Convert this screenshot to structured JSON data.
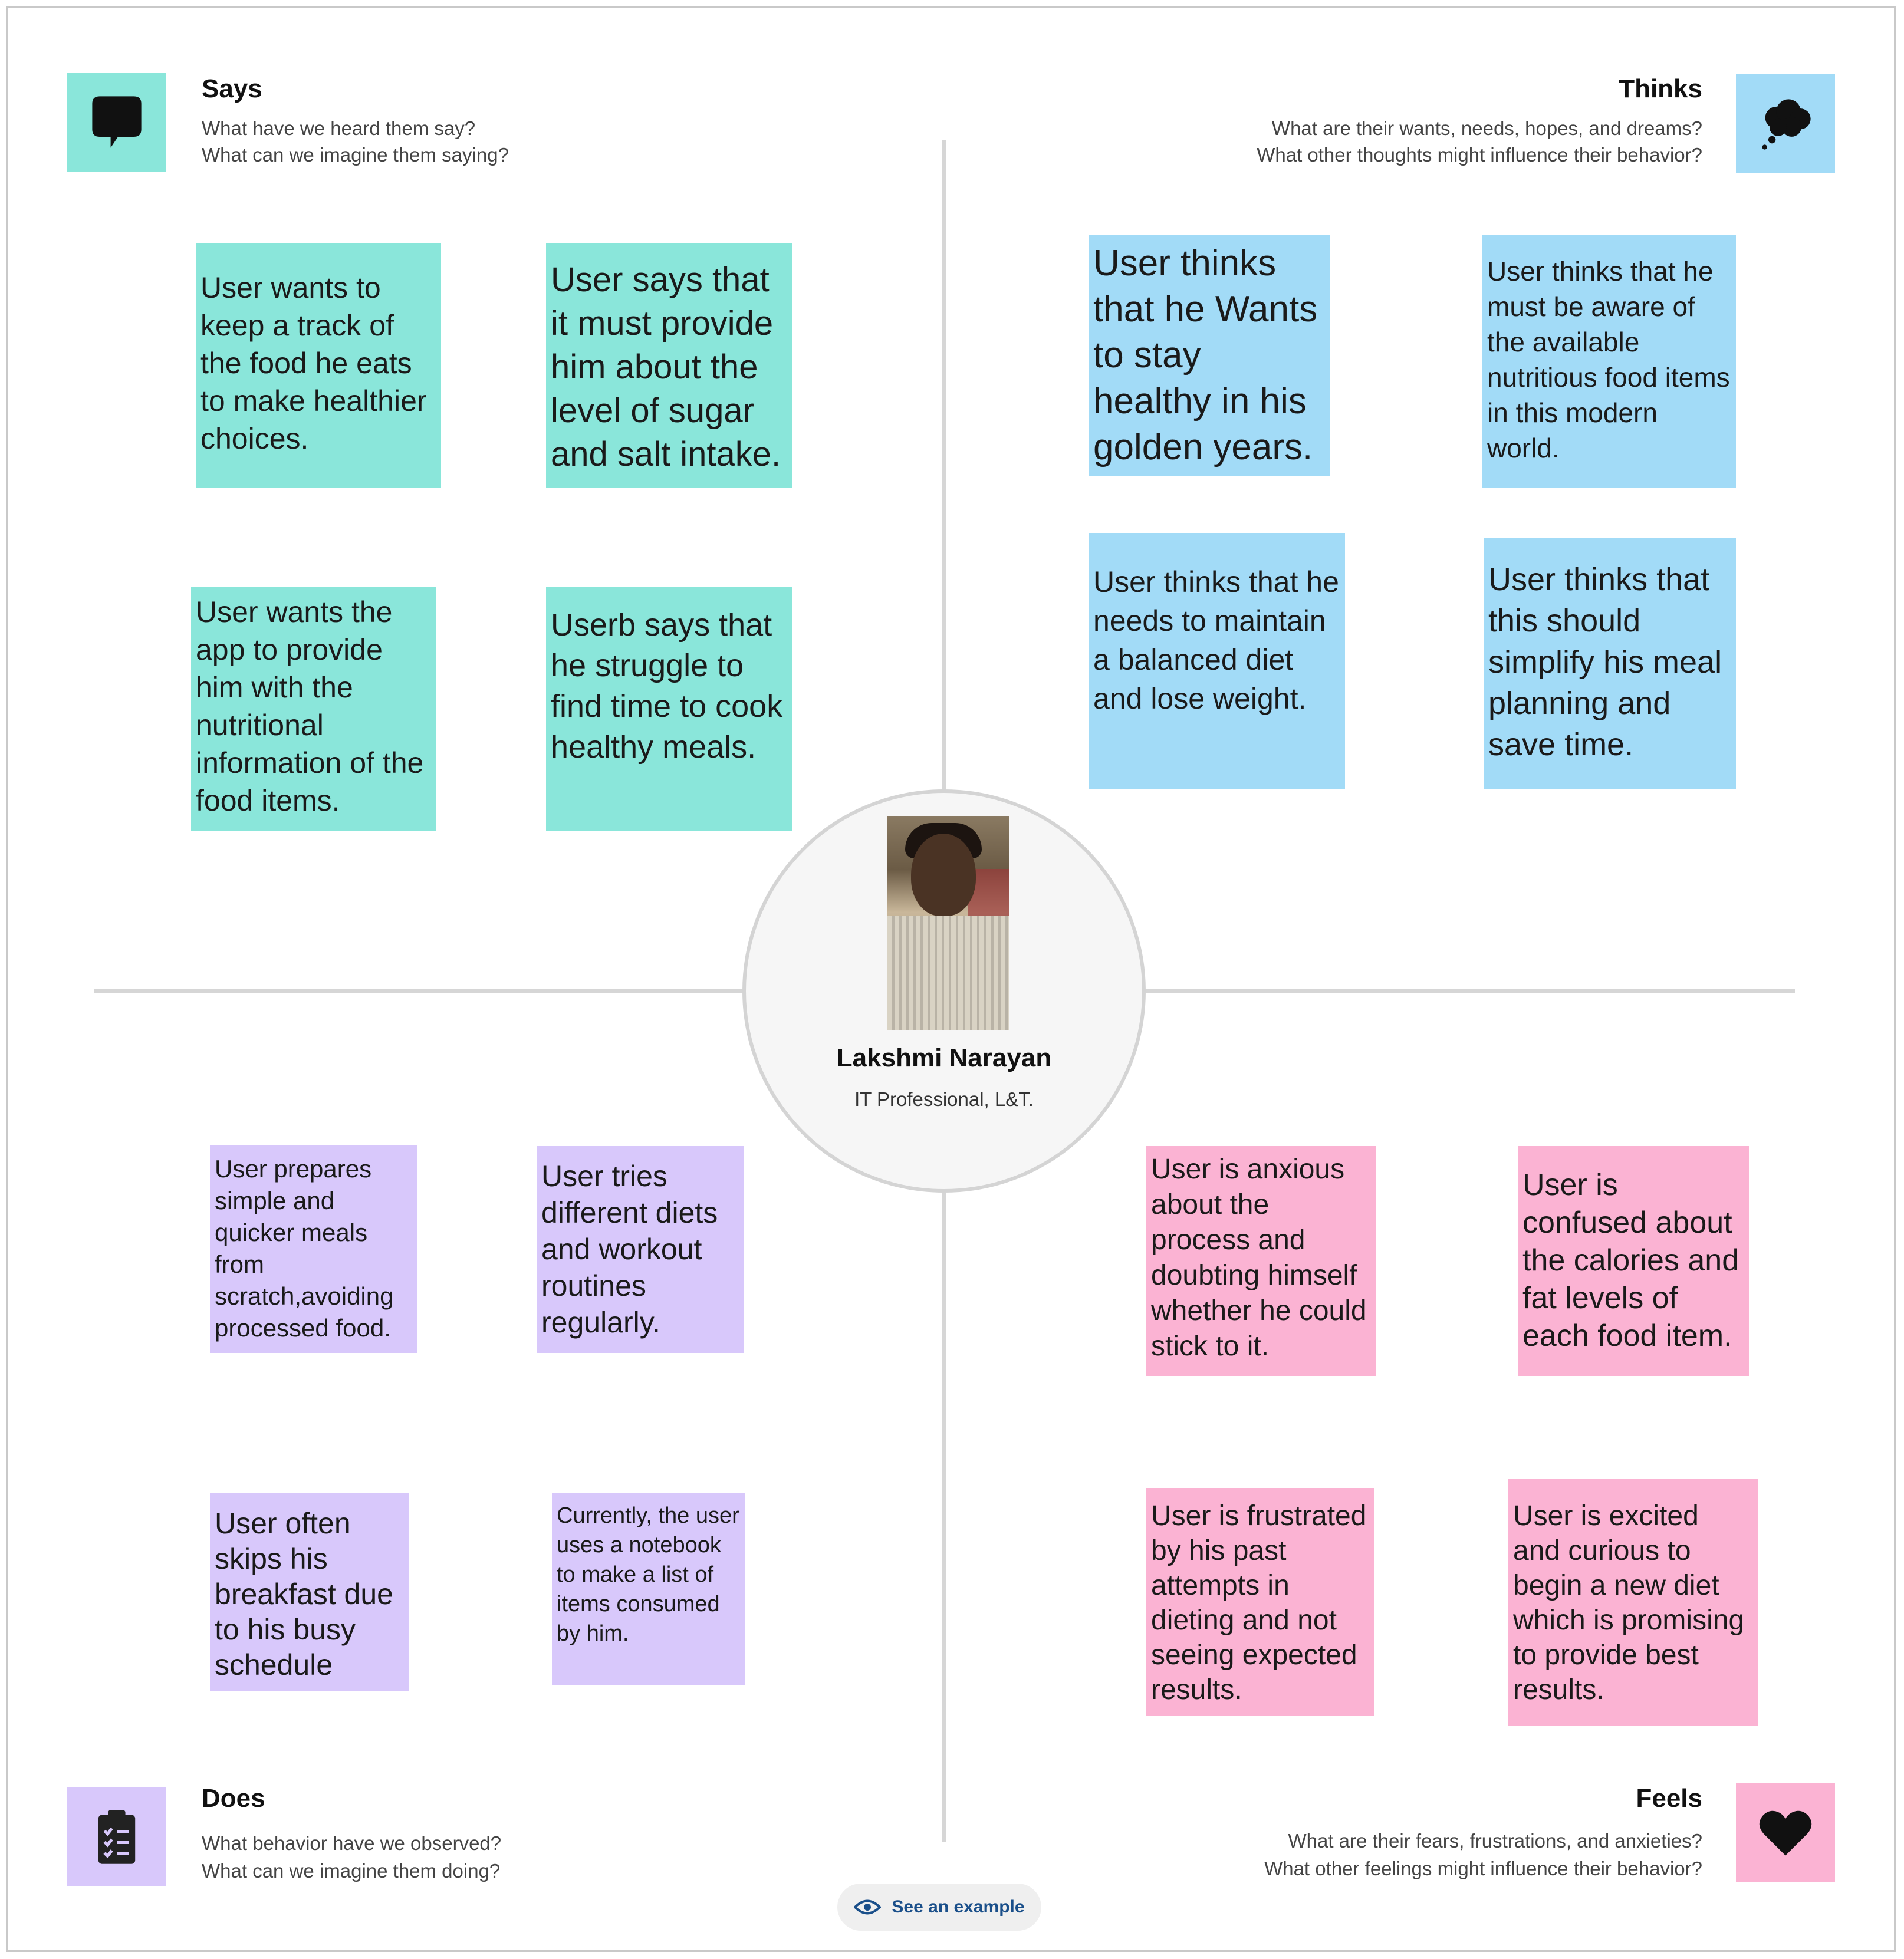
{
  "quadrants": {
    "says": {
      "title": "Says",
      "sub1": "What have we heard them say?",
      "sub2": "What can we imagine them saying?",
      "icon": "speech-bubble-icon",
      "color": "#8ae6da"
    },
    "thinks": {
      "title": "Thinks",
      "sub1": "What are their wants, needs, hopes, and dreams?",
      "sub2": "What other thoughts might influence their behavior?",
      "icon": "thought-cloud-icon",
      "color": "#a2dbf7"
    },
    "does": {
      "title": "Does",
      "sub1": "What behavior have we observed?",
      "sub2": "What can we imagine them doing?",
      "icon": "clipboard-icon",
      "color": "#d8c8fb"
    },
    "feels": {
      "title": "Feels",
      "sub1": "What are their fears, frustrations, and anxieties?",
      "sub2": "What other feelings might influence their behavior?",
      "icon": "heart-icon",
      "color": "#fbb3d3"
    }
  },
  "persona": {
    "name": "Lakshmi Narayan",
    "role": "IT Professional, L&T."
  },
  "notes": {
    "says": [
      "User wants to keep a track of the food he eats to make healthier choices.",
      "User says that it must provide him about the level of sugar and salt intake.",
      "User wants the app to provide him with the nutritional information of the food items.",
      "Userb says that he struggle to find time to cook healthy meals."
    ],
    "thinks": [
      "User thinks that he Wants to stay healthy in his golden years.",
      "User thinks that he must be aware of the available nutritious food items in this modern world.",
      "User thinks that he needs to maintain a balanced diet and lose weight.",
      "User thinks that this should simplify his meal planning and save time."
    ],
    "does": [
      "User prepares simple and quicker meals from scratch,avoiding processed food.",
      "User tries different diets and workout routines regularly.",
      "User often skips his breakfast due to his busy schedule",
      "Currently, the user uses a notebook to make a list of items consumed by him."
    ],
    "feels": [
      "User is anxious about the process and doubting himself whether he could stick to it.",
      "User is confused about the calories and fat levels of each food item.",
      "User is frustrated by his past attempts in dieting and not seeing expected results.",
      "User is excited and curious to begin a new  diet which is promising to provide best results."
    ]
  },
  "example_button": {
    "label": "See an example",
    "icon": "eye-icon"
  }
}
